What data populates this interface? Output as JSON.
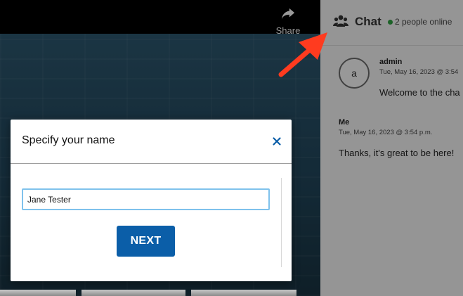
{
  "share": {
    "label": "Share",
    "icon": "share-arrow-icon"
  },
  "chat": {
    "title": "Chat",
    "online_text": "2 people online",
    "online_color": "#2e9e3f",
    "messages": [
      {
        "avatar": "a",
        "author": "admin",
        "time": "Tue, May 16, 2023 @ 3:54",
        "text": "Welcome to the cha"
      },
      {
        "author": "Me",
        "time": "Tue, May 16, 2023 @ 3:54 p.m.",
        "text": "Thanks, it's great to be here!"
      }
    ]
  },
  "modal": {
    "title": "Specify your name",
    "name_value": "Jane Tester",
    "next_label": "NEXT",
    "accent": "#0b5ea8"
  },
  "annotation": {
    "color": "#ff3b1f",
    "icon": "red-arrow-pointer"
  }
}
